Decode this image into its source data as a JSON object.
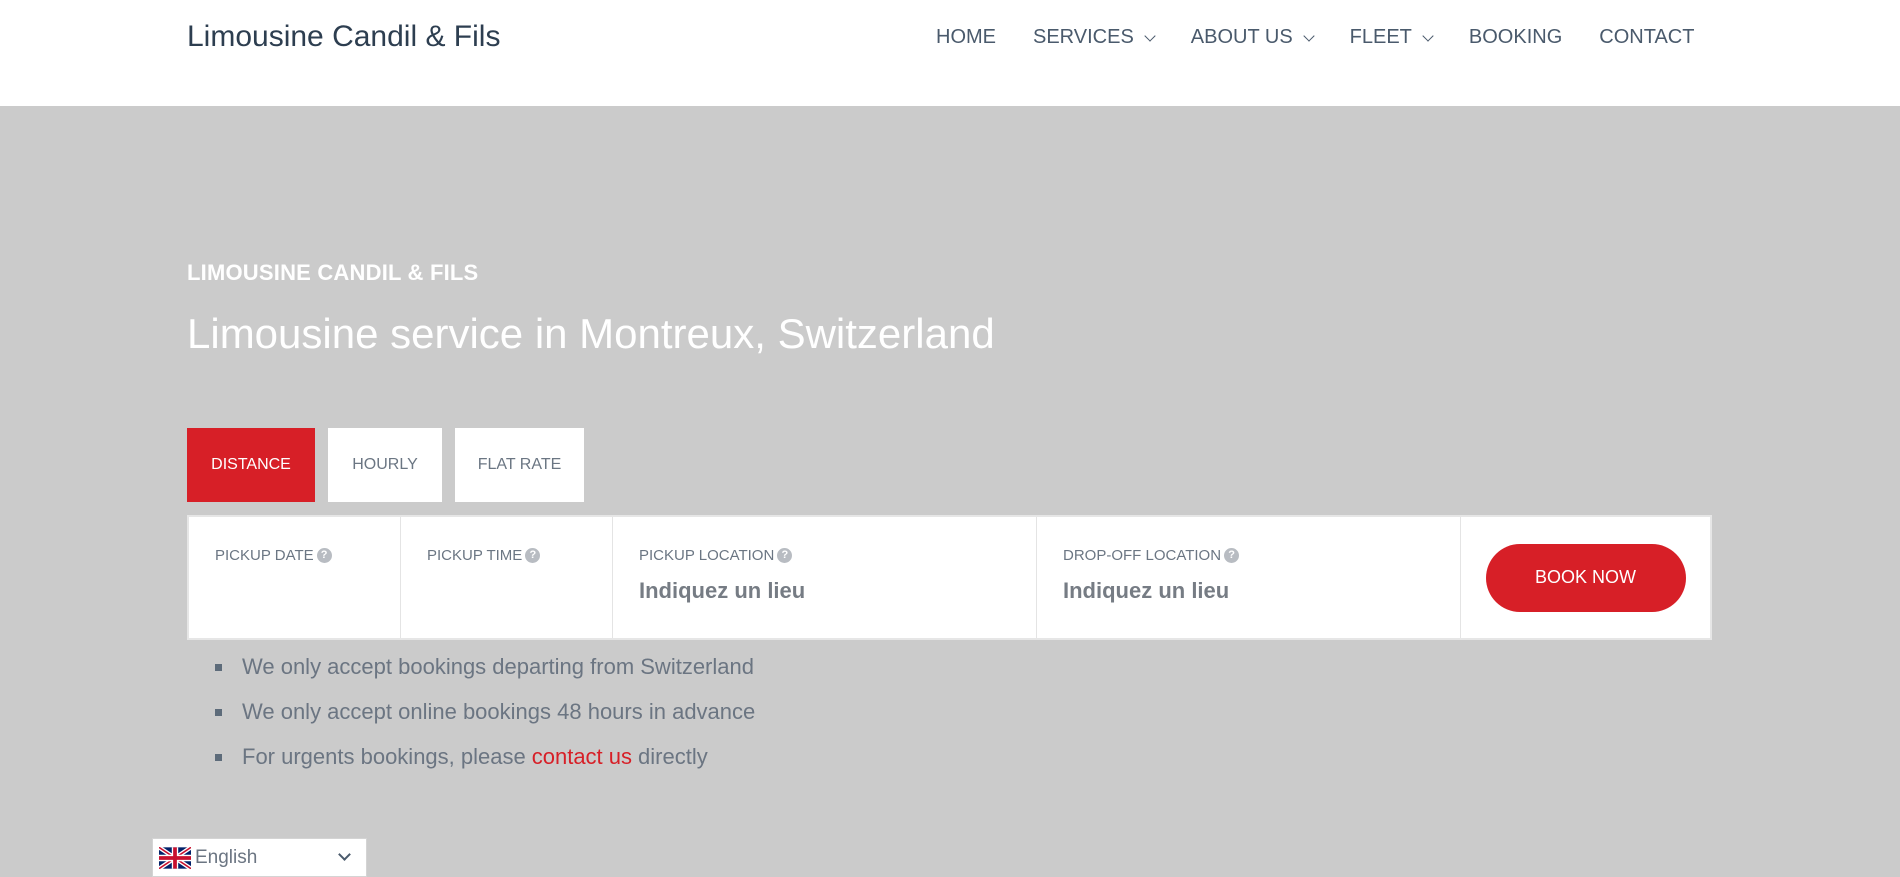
{
  "header": {
    "logo": "Limousine Candil & Fils",
    "nav": [
      {
        "label": "HOME",
        "has_dropdown": false
      },
      {
        "label": "SERVICES",
        "has_dropdown": true
      },
      {
        "label": "ABOUT US",
        "has_dropdown": true
      },
      {
        "label": "FLEET",
        "has_dropdown": true
      },
      {
        "label": "BOOKING",
        "has_dropdown": false
      },
      {
        "label": "CONTACT",
        "has_dropdown": false
      }
    ]
  },
  "hero": {
    "eyebrow": "LIMOUSINE CANDIL & FILS",
    "headline": "Limousine service in Montreux, Switzerland"
  },
  "booking": {
    "tabs": [
      {
        "label": "DISTANCE",
        "active": true
      },
      {
        "label": "HOURLY",
        "active": false
      },
      {
        "label": "FLAT RATE",
        "active": false
      }
    ],
    "fields": {
      "pickup_date": {
        "label": "PICKUP DATE",
        "value": ""
      },
      "pickup_time": {
        "label": "PICKUP TIME",
        "value": ""
      },
      "pickup_location": {
        "label": "PICKUP LOCATION",
        "placeholder": "Indiquez un lieu"
      },
      "dropoff_location": {
        "label": "DROP-OFF LOCATION",
        "placeholder": "Indiquez un lieu"
      }
    },
    "help_glyph": "?",
    "submit_label": "BOOK NOW"
  },
  "notes": {
    "item1": "We only accept bookings departing from Switzerland",
    "item2": "We only accept online bookings 48 hours in advance",
    "item3_before": "For urgents bookings, please",
    "item3_link": "contact us",
    "item3_after": "directly"
  },
  "language": {
    "selected": "English",
    "flag_icon": "uk-flag-icon"
  },
  "colors": {
    "accent": "#d71f27",
    "hero_bg": "#cbcbcb",
    "header_bg": "#ffffff",
    "text": "#4a5a6c"
  }
}
